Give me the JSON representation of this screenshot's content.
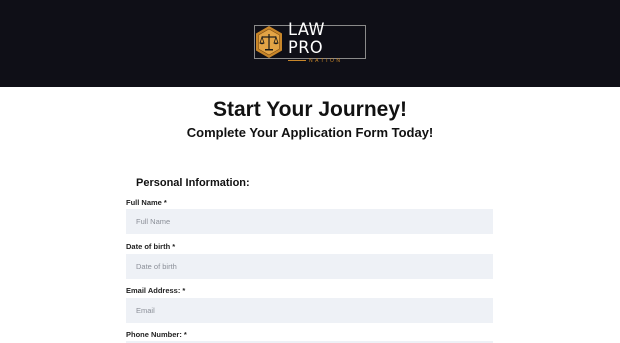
{
  "header": {
    "logo_title": "LAW PRO",
    "logo_subtitle": "NATION",
    "background_color": "#0f0f17",
    "accent_color": "#c8862a"
  },
  "main": {
    "title": "Start Your Journey!",
    "subtitle": "Complete Your Application Form Today!"
  },
  "form": {
    "section_title": "Personal Information:",
    "fields": [
      {
        "label": "Full Name *",
        "placeholder": "Full Name",
        "value": ""
      },
      {
        "label": "Date of birth *",
        "placeholder": "Date of birth",
        "value": ""
      },
      {
        "label": "Email Address: *",
        "placeholder": "Email",
        "value": ""
      },
      {
        "label": "Phone Number: *",
        "placeholder": "",
        "value": ""
      }
    ],
    "input_background": "#eef1f6"
  }
}
